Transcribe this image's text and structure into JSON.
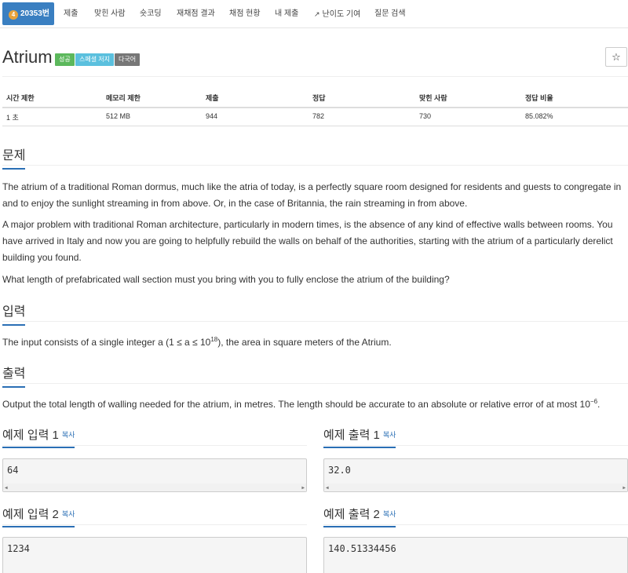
{
  "nav": {
    "problem_number": "20353번",
    "tier_badge": "4",
    "items": [
      "제출",
      "맞힌 사람",
      "숏코딩",
      "재채점 결과",
      "채점 현황",
      "내 제출",
      "난이도 기여",
      "질문 검색"
    ]
  },
  "problem": {
    "title": "Atrium",
    "labels": [
      "성공",
      "스페셜 저지",
      "다국어"
    ],
    "star": "☆"
  },
  "stats": {
    "headers": [
      "시간 제한",
      "메모리 제한",
      "제출",
      "정답",
      "맞힌 사람",
      "정답 비율"
    ],
    "values": [
      "1 초",
      "512 MB",
      "944",
      "782",
      "730",
      "85.082%"
    ]
  },
  "sections": {
    "description_title": "문제",
    "description": [
      "The atrium of a traditional Roman dormus, much like the atria of today, is a perfectly square room designed for residents and guests to congregate in and to enjoy the sunlight streaming in from above. Or, in the case of Britannia, the rain streaming in from above.",
      "A major problem with traditional Roman architecture, particularly in modern times, is the absence of any kind of effective walls between rooms. You have arrived in Italy and now you are going to helpfully rebuild the walls on behalf of the authorities, starting with the atrium of a particularly derelict building you found.",
      "What length of prefabricated wall section must you bring with you to fully enclose the atrium of the building?"
    ],
    "input_title": "입력",
    "input_pre": "The input consists of a single integer a (1 ≤ a ≤ 10",
    "input_sup": "18",
    "input_post": "), the area in square meters of the Atrium.",
    "output_title": "출력",
    "output_pre": "Output the total length of walling needed for the atrium, in metres. The length should be accurate to an absolute or relative error of at most 10",
    "output_sup": "−6",
    "output_post": "."
  },
  "samples": {
    "copy_label": "복사",
    "in1_title": "예제 입력 1",
    "out1_title": "예제 출력 1",
    "in2_title": "예제 입력 2",
    "out2_title": "예제 출력 2",
    "in1": "64",
    "out1": "32.0",
    "in2": "1234",
    "out2": "140.51334456"
  },
  "colors": {
    "primary": "#3a7fc1",
    "success": "#5cb85c",
    "info": "#5bc0de",
    "default": "#777777"
  }
}
